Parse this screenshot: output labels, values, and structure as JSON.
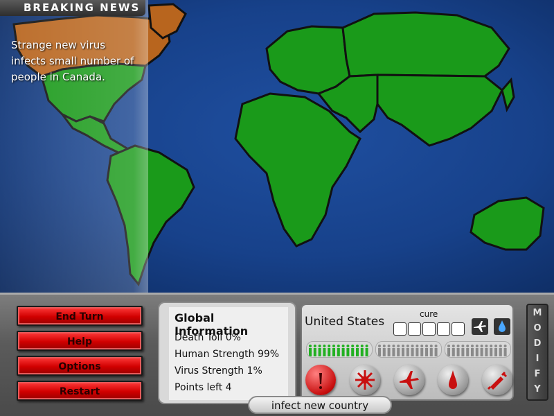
{
  "news": {
    "header": "BREAKING NEWS",
    "message": "Strange new virus infects small number of people in Canada."
  },
  "map": {
    "ocean_color": "#17418a",
    "land_color": "#1a9a1a",
    "infected_color": "#b8651e"
  },
  "buttons": {
    "end_turn": "End Turn",
    "help": "Help",
    "options": "Options",
    "restart": "Restart"
  },
  "global": {
    "title": "Global Information",
    "death_toll": "Death Toll  0%",
    "human_strength": "Human Strength  99%",
    "virus_strength": "Virus Strength  1%",
    "points_left": "Points left  4"
  },
  "country": {
    "name": "United States",
    "cure_label": "cure",
    "cure_progress": 0,
    "healthy_color": "#22b022",
    "empty_color": "#8a8a8a"
  },
  "actions": {
    "infect_label": "infect new country",
    "icons": [
      "virus-icon",
      "spread-icon",
      "airplane-icon",
      "water-drop-icon",
      "syringe-icon"
    ]
  },
  "modify": {
    "letters": [
      "M",
      "O",
      "D",
      "I",
      "F",
      "Y"
    ]
  }
}
